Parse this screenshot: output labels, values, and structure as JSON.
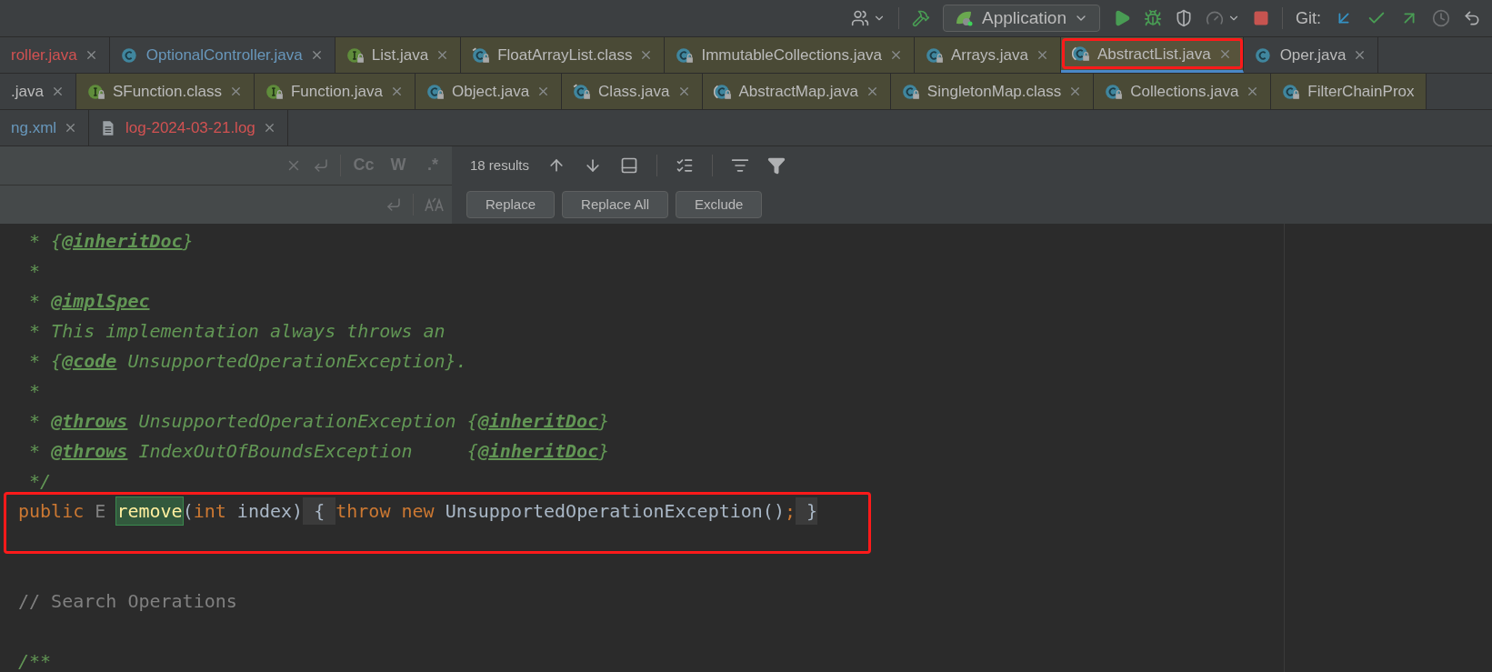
{
  "toolbar": {
    "run_config": "Application",
    "vcs_label": "Git:"
  },
  "tab_rows": [
    {
      "tabs": [
        {
          "label": "roller.java",
          "kind": "none",
          "locked": false,
          "color": "#d25252",
          "library": false,
          "selected": false,
          "closable": true,
          "annotated": false
        },
        {
          "label": "OptionalController.java",
          "kind": "class",
          "locked": false,
          "color": "#6897bb",
          "library": false,
          "selected": false,
          "closable": true,
          "annotated": false
        },
        {
          "label": "List.java",
          "kind": "interface",
          "locked": true,
          "color": "#bbbbbb",
          "library": true,
          "selected": false,
          "closable": true,
          "annotated": false
        },
        {
          "label": "FloatArrayList.class",
          "kind": "compiled",
          "locked": true,
          "color": "#bbbbbb",
          "library": true,
          "selected": false,
          "closable": true,
          "annotated": false
        },
        {
          "label": "ImmutableCollections.java",
          "kind": "class",
          "locked": true,
          "color": "#bbbbbb",
          "library": true,
          "selected": false,
          "closable": true,
          "annotated": false
        },
        {
          "label": "Arrays.java",
          "kind": "class",
          "locked": true,
          "color": "#bbbbbb",
          "library": true,
          "selected": false,
          "closable": true,
          "annotated": false
        },
        {
          "label": "AbstractList.java",
          "kind": "abstract",
          "locked": true,
          "color": "#bbbbbb",
          "library": true,
          "selected": true,
          "closable": true,
          "annotated": true
        },
        {
          "label": "Oper.java",
          "kind": "class",
          "locked": false,
          "color": "#bbbbbb",
          "library": false,
          "selected": false,
          "closable": true,
          "annotated": false
        }
      ]
    },
    {
      "tabs": [
        {
          "label": ".java",
          "kind": "none",
          "locked": false,
          "color": "#bbbbbb",
          "library": false,
          "selected": false,
          "closable": true,
          "annotated": false
        },
        {
          "label": "SFunction.class",
          "kind": "interface",
          "locked": true,
          "color": "#bbbbbb",
          "library": true,
          "selected": false,
          "closable": true,
          "annotated": false
        },
        {
          "label": "Function.java",
          "kind": "interface",
          "locked": true,
          "color": "#bbbbbb",
          "library": true,
          "selected": false,
          "closable": true,
          "annotated": false
        },
        {
          "label": "Object.java",
          "kind": "class",
          "locked": true,
          "color": "#bbbbbb",
          "library": true,
          "selected": false,
          "closable": true,
          "annotated": false
        },
        {
          "label": "Class.java",
          "kind": "compiled",
          "locked": true,
          "color": "#bbbbbb",
          "library": true,
          "selected": false,
          "closable": true,
          "annotated": false
        },
        {
          "label": "AbstractMap.java",
          "kind": "abstract",
          "locked": true,
          "color": "#bbbbbb",
          "library": true,
          "selected": false,
          "closable": true,
          "annotated": false
        },
        {
          "label": "SingletonMap.class",
          "kind": "class",
          "locked": true,
          "color": "#bbbbbb",
          "library": true,
          "selected": false,
          "closable": true,
          "annotated": false
        },
        {
          "label": "Collections.java",
          "kind": "class",
          "locked": true,
          "color": "#bbbbbb",
          "library": true,
          "selected": false,
          "closable": true,
          "annotated": false
        },
        {
          "label": "FilterChainProx",
          "kind": "class",
          "locked": true,
          "color": "#bbbbbb",
          "library": true,
          "selected": false,
          "closable": false,
          "annotated": false
        }
      ]
    },
    {
      "tabs": [
        {
          "label": "ng.xml",
          "kind": "none",
          "locked": false,
          "color": "#6897bb",
          "library": false,
          "selected": false,
          "closable": true,
          "annotated": false
        },
        {
          "label": "log-2024-03-21.log",
          "kind": "file",
          "locked": false,
          "color": "#d25252",
          "library": false,
          "selected": false,
          "closable": true,
          "annotated": false
        }
      ]
    }
  ],
  "find_bar": {
    "search_toggles": [
      "Cc",
      "W",
      ".*"
    ],
    "result_count": "18 results",
    "buttons": [
      "Replace",
      "Replace All",
      "Exclude"
    ]
  },
  "code_lines": [
    {
      "kind": "code",
      "annotated": false,
      "tokens": [
        {
          "kind": "comment",
          "text": " * {"
        },
        {
          "kind": "doc-tag",
          "text": "@inheritDoc"
        },
        {
          "kind": "comment",
          "text": "}"
        }
      ]
    },
    {
      "kind": "code",
      "annotated": false,
      "tokens": [
        {
          "kind": "comment",
          "text": " *"
        }
      ]
    },
    {
      "kind": "code",
      "annotated": false,
      "tokens": [
        {
          "kind": "comment",
          "text": " * "
        },
        {
          "kind": "doc-tag",
          "text": "@implSpec"
        }
      ]
    },
    {
      "kind": "code",
      "annotated": false,
      "tokens": [
        {
          "kind": "comment",
          "text": " * This implementation always throws an"
        }
      ]
    },
    {
      "kind": "code",
      "annotated": false,
      "tokens": [
        {
          "kind": "comment",
          "text": " * {"
        },
        {
          "kind": "doc-tag",
          "text": "@code"
        },
        {
          "kind": "comment",
          "text": " UnsupportedOperationException}."
        }
      ]
    },
    {
      "kind": "code",
      "annotated": false,
      "tokens": [
        {
          "kind": "comment",
          "text": " *"
        }
      ]
    },
    {
      "kind": "code",
      "annotated": false,
      "tokens": [
        {
          "kind": "comment",
          "text": " * "
        },
        {
          "kind": "doc-tag",
          "text": "@throws"
        },
        {
          "kind": "comment",
          "text": " UnsupportedOperationException {"
        },
        {
          "kind": "doc-tag",
          "text": "@inheritDoc"
        },
        {
          "kind": "comment",
          "text": "}"
        }
      ]
    },
    {
      "kind": "code",
      "annotated": false,
      "tokens": [
        {
          "kind": "comment",
          "text": " * "
        },
        {
          "kind": "doc-tag",
          "text": "@throws"
        },
        {
          "kind": "comment",
          "text": " IndexOutOfBoundsException     {"
        },
        {
          "kind": "doc-tag",
          "text": "@inheritDoc"
        },
        {
          "kind": "comment",
          "text": "}"
        }
      ]
    },
    {
      "kind": "code",
      "annotated": false,
      "tokens": [
        {
          "kind": "comment",
          "text": " */"
        }
      ]
    },
    {
      "kind": "code",
      "annotated": true,
      "tokens": [
        {
          "kind": "keyword",
          "text": "public "
        },
        {
          "kind": "type-param",
          "text": "E "
        },
        {
          "kind": "match",
          "text": "remove"
        },
        {
          "kind": "plain",
          "text": "("
        },
        {
          "kind": "keyword",
          "text": "int "
        },
        {
          "kind": "plain",
          "text": "index)"
        },
        {
          "kind": "fold",
          "text": " { "
        },
        {
          "kind": "keyword",
          "text": "throw new "
        },
        {
          "kind": "plain",
          "text": "UnsupportedOperationException()"
        },
        {
          "kind": "keyword",
          "text": ";"
        },
        {
          "kind": "fold",
          "text": " }"
        }
      ]
    },
    {
      "kind": "blank"
    },
    {
      "kind": "blank"
    },
    {
      "kind": "code",
      "annotated": false,
      "tokens": [
        {
          "kind": "line-comment",
          "text": "// Search Operations"
        }
      ]
    },
    {
      "kind": "blank"
    },
    {
      "kind": "code",
      "annotated": false,
      "tokens": [
        {
          "kind": "comment",
          "text": "/**"
        }
      ]
    }
  ]
}
